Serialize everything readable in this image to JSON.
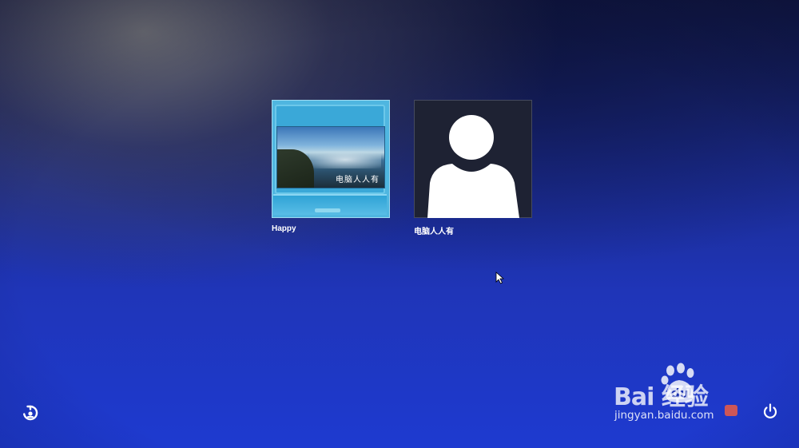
{
  "users": [
    {
      "name": "Happy",
      "avatar": "laptop-picture",
      "screen_text": "电脑人人有"
    },
    {
      "name": "电脑人人有",
      "avatar": "default-user-silhouette"
    }
  ],
  "bottom_controls": {
    "left_icon": "ease-of-access-icon",
    "right_icon": "power-icon"
  },
  "watermark": {
    "logo_text": "Bai  经验",
    "url": "jingyan.baidu.com"
  },
  "colors": {
    "background_top": "#141c4e",
    "background_bottom": "#1e3ad0",
    "label_text": "#ffffff"
  }
}
